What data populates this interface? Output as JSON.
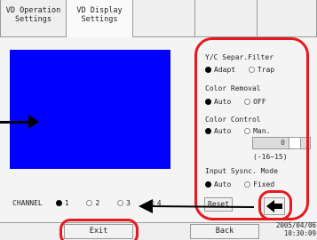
{
  "tabs": [
    {
      "line1": "VD Operation",
      "line2": "Settings",
      "selected": false
    },
    {
      "line1": "VD Display",
      "line2": "Settings",
      "selected": true
    }
  ],
  "video_preview": {
    "color": "#0000ff"
  },
  "panel": {
    "yc_filter": {
      "title": "Y/C Separ.Filter",
      "options": [
        "Adapt",
        "Trap"
      ],
      "selected": "Adapt"
    },
    "color_removal": {
      "title": "Color Removal",
      "options": [
        "Auto",
        "OFF"
      ],
      "selected": "Auto"
    },
    "color_control": {
      "title": "Color Control",
      "options": [
        "Auto",
        "Man."
      ],
      "selected": "Auto",
      "value": "0",
      "range": "(-16~15)"
    },
    "input_sync": {
      "title": "Input Sysnc. Mode",
      "options": [
        "Auto",
        "Fixed"
      ],
      "selected": "Auto"
    }
  },
  "channel": {
    "label": "CHANNEL",
    "options": [
      "1",
      "2",
      "3",
      "4"
    ],
    "selected": "1"
  },
  "buttons": {
    "reset": "Reset",
    "exit": "Exit",
    "back": "Back",
    "back_arrow_icon": "left-arrow-icon"
  },
  "clock": {
    "date": "2005/04/06",
    "time": "10:30:09"
  },
  "annotation_color": "#e8191e"
}
